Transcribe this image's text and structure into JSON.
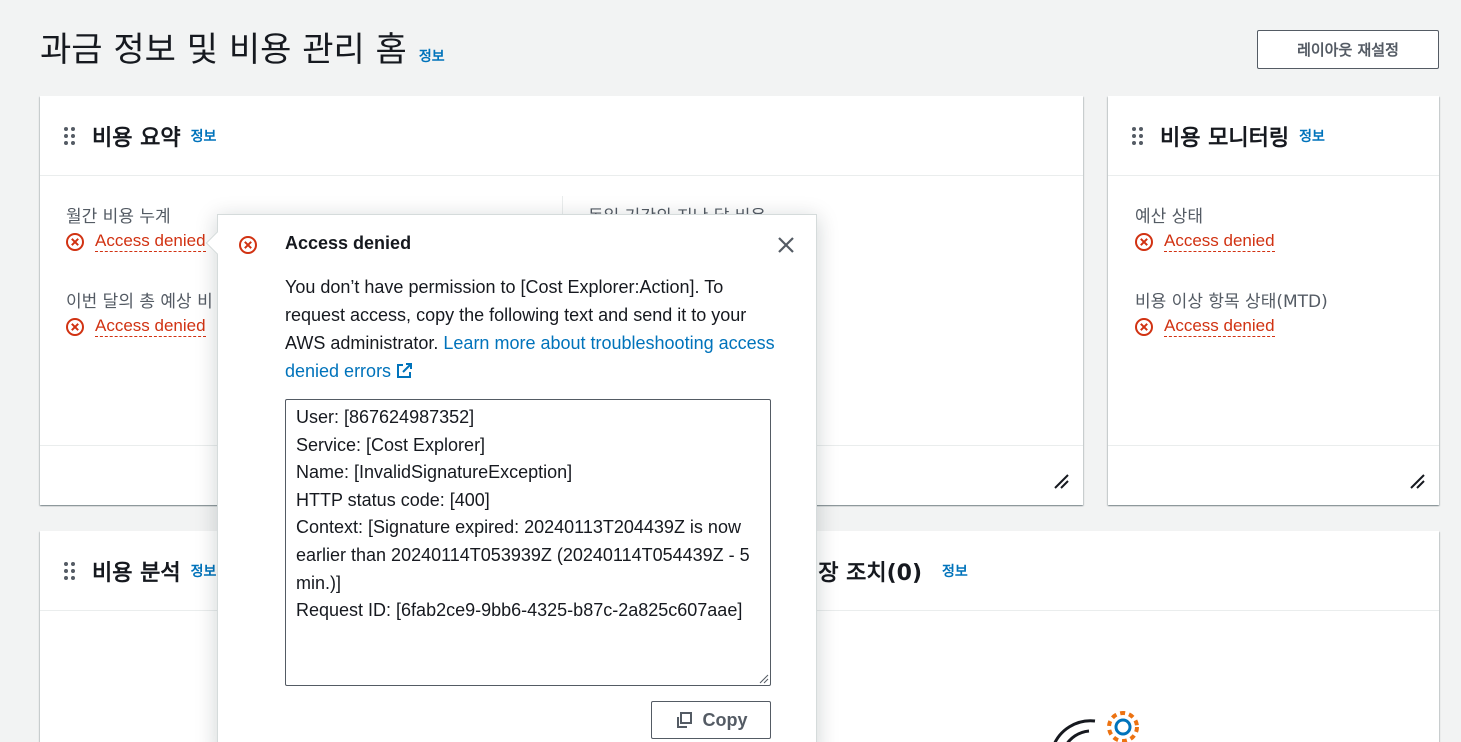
{
  "page": {
    "title": "과금 정보 및 비용 관리 홈",
    "info_label": "정보",
    "reset_layout_label": "레이아웃 재설정"
  },
  "cost_summary": {
    "title": "비용 요약",
    "info_label": "정보",
    "month_to_date_label": "월간 비용 누계",
    "month_to_date_value": "Access denied",
    "forecast_label": "이번 달의 총 예상 비",
    "forecast_value": "Access denied",
    "last_period_label": "동일 기간의 지난 달 비용"
  },
  "cost_monitoring": {
    "title": "비용 모니터링",
    "info_label": "정보",
    "budget_label": "예산 상태",
    "budget_value": "Access denied",
    "anomaly_label": "비용 이상 항목 상태(MTD)",
    "anomaly_value": "Access denied"
  },
  "cost_analysis": {
    "title": "비용 분석",
    "info_label": "정보"
  },
  "recommended_actions": {
    "title": "권장 조치(0)",
    "info_label": "정보"
  },
  "popover": {
    "title": "Access denied",
    "message": "You don’t have permission to [Cost Explorer:Action]. To request access, copy the following text and send it to your AWS administrator.",
    "link_text": "Learn more about troubleshooting access denied errors",
    "details": "User: [867624987352]\nService: [Cost Explorer]\nName: [InvalidSignatureException]\nHTTP status code: [400]\nContext: [Signature expired: 20240113T204439Z is now earlier than 20240114T053939Z (20240114T054439Z - 5 min.)]\nRequest ID: [6fab2ce9-9bb6-4325-b87c-2a825c607aae]",
    "copy_label": "Copy"
  },
  "colors": {
    "error": "#d13212",
    "link": "#0073bb",
    "text": "#16191f",
    "secondary": "#545b64",
    "background": "#f2f3f3"
  }
}
